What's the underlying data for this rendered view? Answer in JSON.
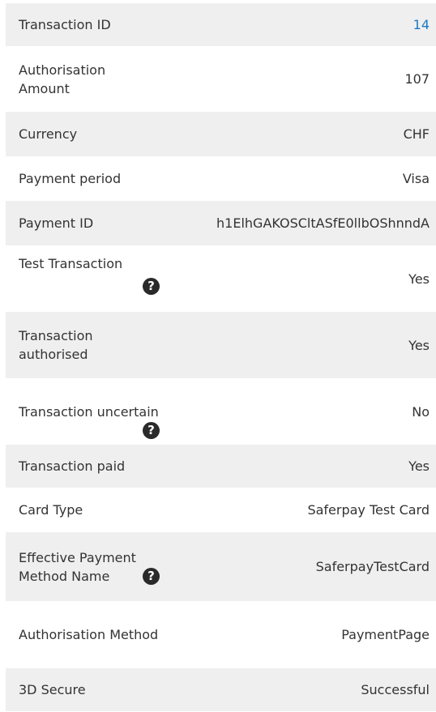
{
  "rows": [
    {
      "label": "Transaction ID",
      "value": "14"
    },
    {
      "label": "Authorisation Amount",
      "value": "107"
    },
    {
      "label": "Currency",
      "value": "CHF"
    },
    {
      "label": "Payment period",
      "value": "Visa"
    },
    {
      "label": "Payment ID",
      "value": "h1ElhGAKOSCltASfE0llbOShnndA"
    },
    {
      "label": "Test Transaction",
      "value": "Yes"
    },
    {
      "label": "Transaction authorised",
      "value": "Yes"
    },
    {
      "label": "Transaction uncertain",
      "value": "No"
    },
    {
      "label": "Transaction paid",
      "value": "Yes"
    },
    {
      "label": "Card Type",
      "value": "Saferpay Test Card"
    },
    {
      "label": "Effective Payment Method Name",
      "value": "SaferpayTestCard"
    },
    {
      "label": "Authorisation Method",
      "value": "PaymentPage"
    },
    {
      "label": "3D Secure",
      "value": "Successful"
    }
  ],
  "help_icon_glyph": "?",
  "colors": {
    "shade": "#efefef",
    "link": "#1979c3",
    "text": "#333333",
    "help_bg": "#2a2a2a"
  },
  "icons": {
    "help": "question-circle-icon"
  }
}
